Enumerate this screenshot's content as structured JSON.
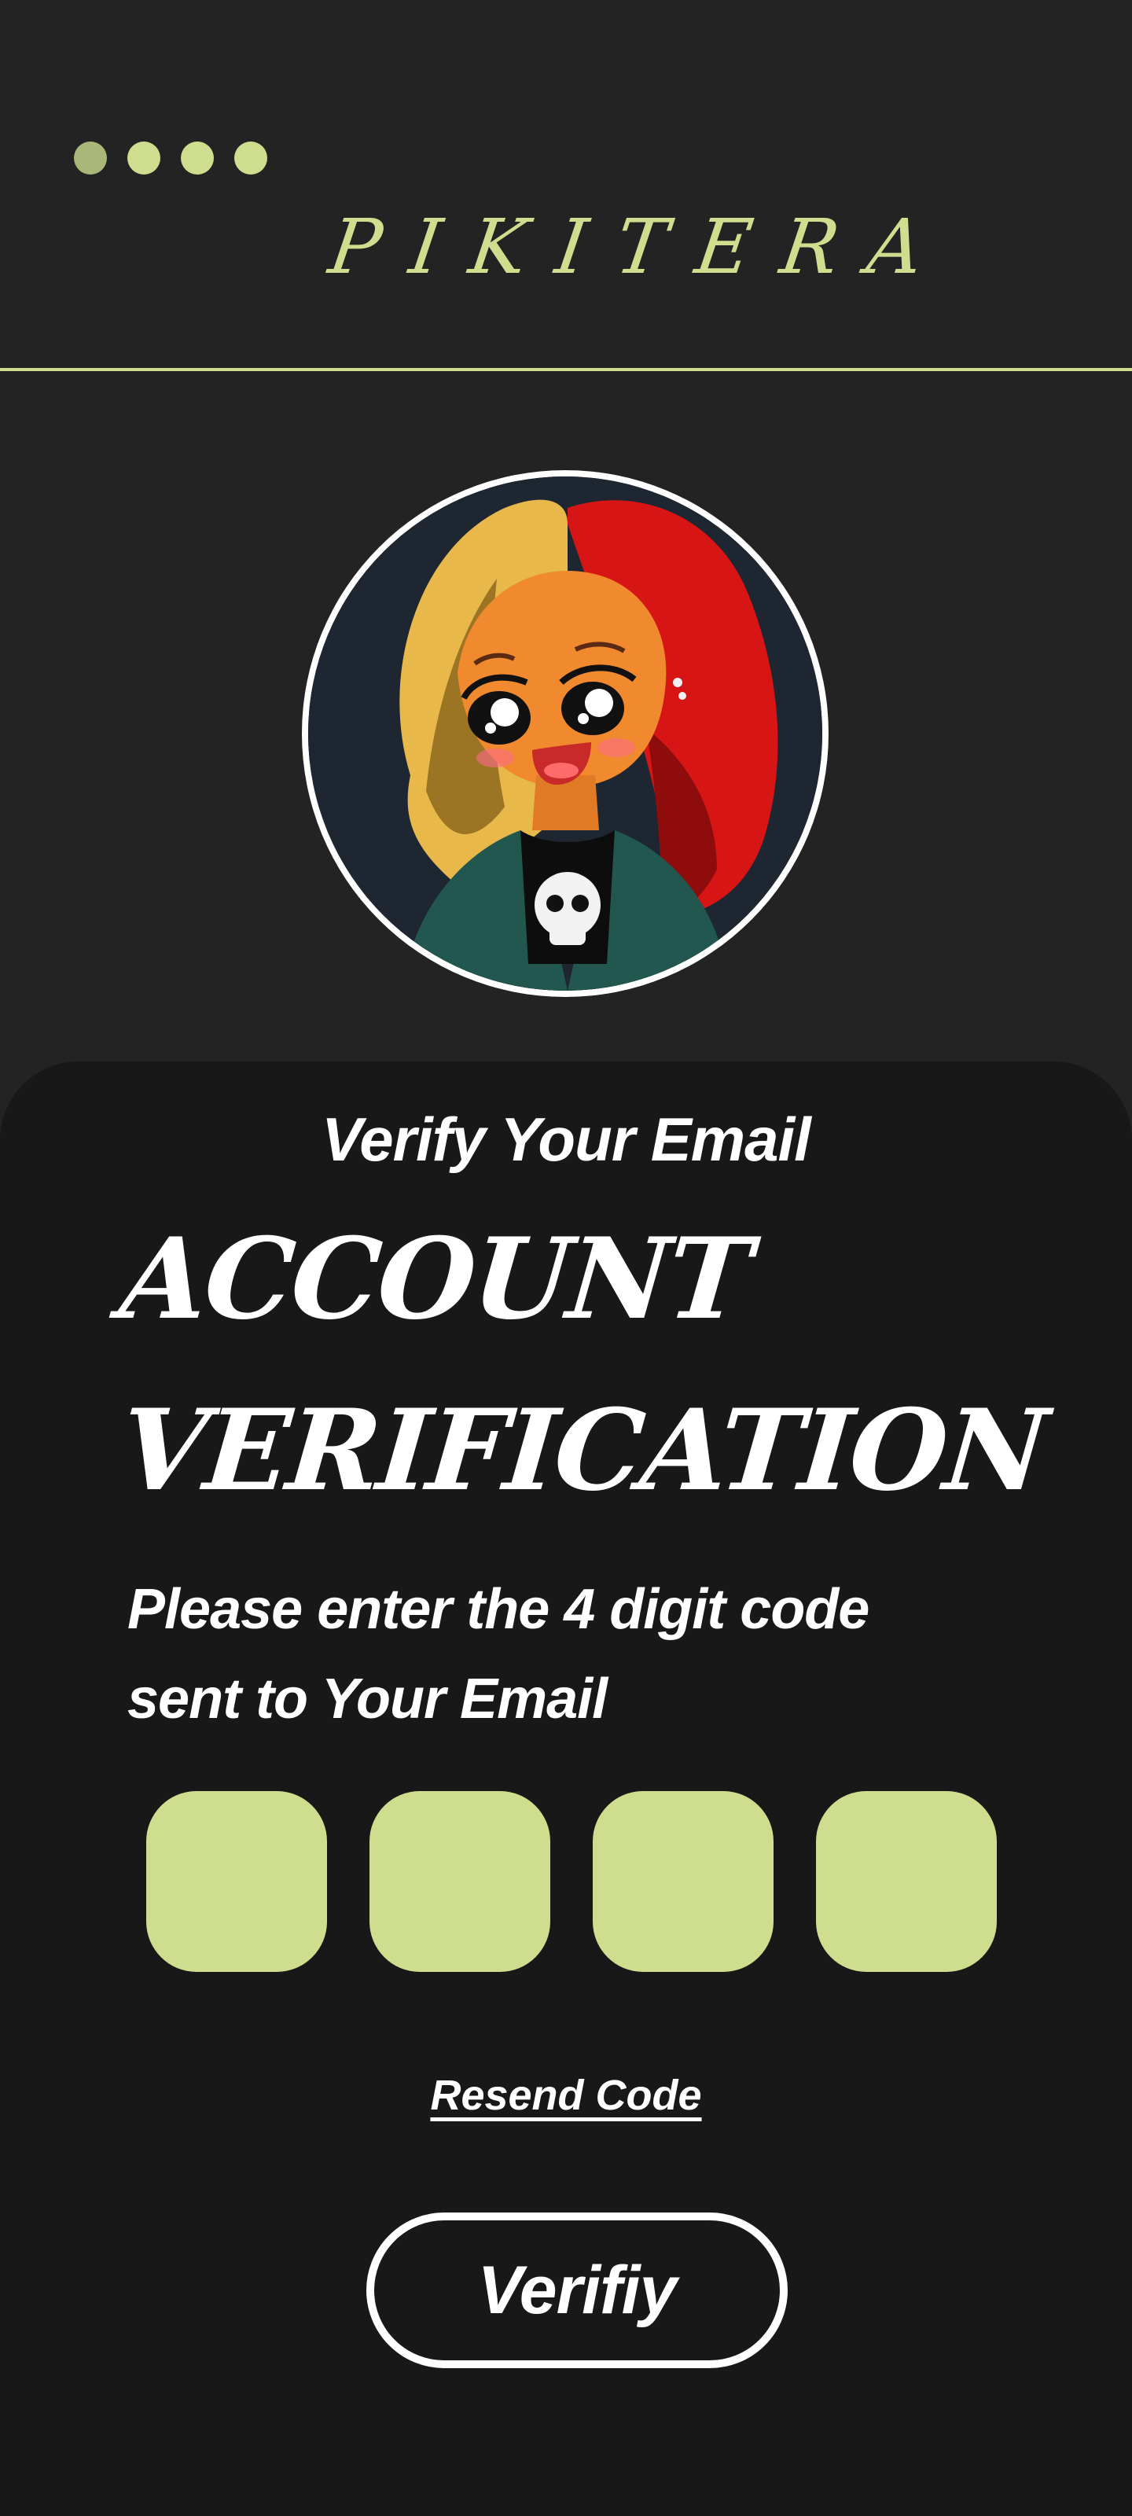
{
  "brand": {
    "name": "PIKITERA"
  },
  "profile": {
    "avatar_icon": "cartoon-avatar-icon"
  },
  "verification": {
    "heading": "Verify Your Email",
    "headline_line1": "ACCOUNT",
    "headline_line2": "VERIFICATION",
    "instruction_line1": "Please enter the 4 digit code",
    "instruction_line2": "sent to Your Email",
    "code_digits": [
      "",
      "",
      "",
      ""
    ],
    "resend_label": "Resend Code",
    "verify_label": "Verifiy"
  },
  "colors": {
    "background": "#232323",
    "card": "#181818",
    "accent": "#cfdd8e",
    "text": "#ffffff"
  }
}
